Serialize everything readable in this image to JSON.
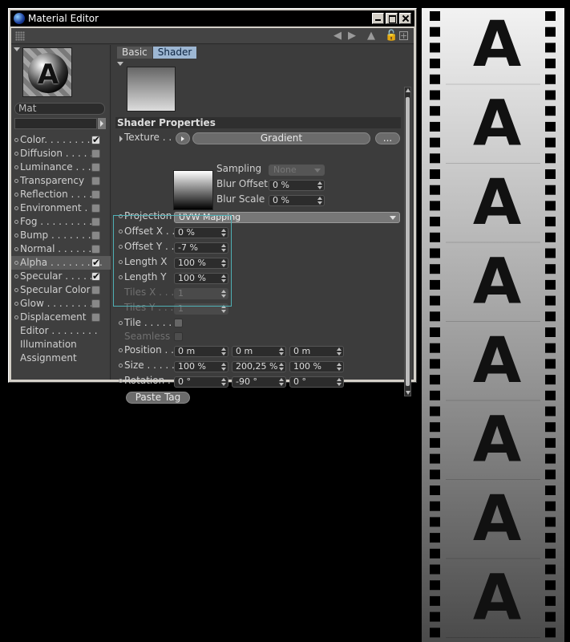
{
  "window": {
    "title": "Material Editor"
  },
  "toolbar": {
    "icons": [
      "grip-icon",
      "arrow-left-icon",
      "arrow-right-icon",
      "pointer-icon",
      "lock-icon",
      "new-window-icon"
    ]
  },
  "material": {
    "preview_letter": "A",
    "name": "Mat"
  },
  "channels": [
    {
      "label": "Color",
      "checked": true,
      "selected": false,
      "has_dot": true
    },
    {
      "label": "Diffusion",
      "checked": false,
      "selected": false,
      "has_dot": true
    },
    {
      "label": "Luminance",
      "checked": false,
      "selected": false,
      "has_dot": true
    },
    {
      "label": "Transparency",
      "checked": false,
      "selected": false,
      "has_dot": true
    },
    {
      "label": "Reflection",
      "checked": false,
      "selected": false,
      "has_dot": true
    },
    {
      "label": "Environment",
      "checked": false,
      "selected": false,
      "has_dot": true
    },
    {
      "label": "Fog",
      "checked": false,
      "selected": false,
      "has_dot": true
    },
    {
      "label": "Bump",
      "checked": false,
      "selected": false,
      "has_dot": true
    },
    {
      "label": "Normal",
      "checked": false,
      "selected": false,
      "has_dot": true
    },
    {
      "label": "Alpha",
      "checked": true,
      "selected": true,
      "has_dot": true
    },
    {
      "label": "Specular",
      "checked": true,
      "selected": false,
      "has_dot": true
    },
    {
      "label": "Specular Color",
      "checked": false,
      "selected": false,
      "has_dot": true
    },
    {
      "label": "Glow",
      "checked": false,
      "selected": false,
      "has_dot": true
    },
    {
      "label": "Displacement",
      "checked": false,
      "selected": false,
      "has_dot": true
    },
    {
      "label": "Editor",
      "checkbox": false,
      "has_dot": false
    },
    {
      "label": "Illumination",
      "checkbox": false,
      "has_dot": false
    },
    {
      "label": "Assignment",
      "checkbox": false,
      "has_dot": false
    }
  ],
  "tabs": {
    "basic": "Basic",
    "shader": "Shader",
    "active": "Shader"
  },
  "shader": {
    "section_title": "Shader Properties",
    "texture_label": "Texture . .",
    "texture_name": "Gradient",
    "more_button": "...",
    "sampling_label": "Sampling",
    "sampling_value": "None",
    "blur_offset_label": "Blur Offset",
    "blur_offset_value": "0 %",
    "blur_scale_label": "Blur Scale",
    "blur_scale_value": "0 %"
  },
  "projection": {
    "projection_label": "Projection",
    "projection_value": "UVW Mapping",
    "offset_x_label": "Offset X . .",
    "offset_x_value": "0 %",
    "offset_y_label": "Offset Y . .",
    "offset_y_value": "-7 %",
    "length_x_label": "Length X",
    "length_x_value": "100 %",
    "length_y_label": "Length Y",
    "length_y_value": "100 %",
    "tiles_x_label": "Tiles X . . .",
    "tiles_x_value": "1",
    "tiles_y_label": "Tiles Y . . .",
    "tiles_y_value": "1",
    "tile_label": "Tile . . . . . .",
    "seamless_label": "Seamless",
    "position_label": "Position . .",
    "position_values": [
      "0 m",
      "0 m",
      "0 m"
    ],
    "size_label": "Size . . . . .",
    "size_values": [
      "100 %",
      "200,25 %",
      "100 %"
    ],
    "rotation_label": "Rotation . .",
    "rotation_values": [
      "0 °",
      "-90 °",
      "0 °"
    ],
    "paste_tag": "Paste Tag"
  },
  "film_strip": {
    "letter": "A",
    "frames": 8
  },
  "colors": {
    "highlight_box": "#4fb0b5",
    "active_tab": "#9db7d3"
  }
}
